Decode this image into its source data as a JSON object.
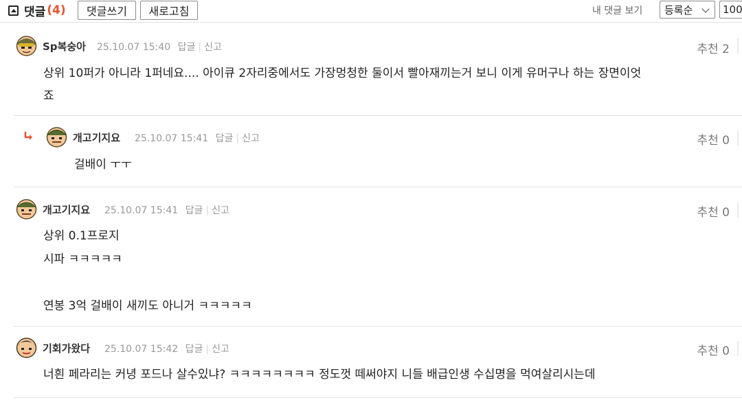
{
  "header": {
    "title": "댓글",
    "count": "(4)",
    "write_button": "댓글쓰기",
    "refresh_button": "새로고침",
    "my_comments": "내 댓글 보기",
    "sort_selected": "등록순",
    "per_page": "100"
  },
  "comments": [
    {
      "nickname": "Sp복숭아",
      "date": "25.10.07 15:40",
      "reply_label": "답글",
      "report_label": "신고",
      "recommend": "추천 2",
      "lines": [
        "상위 10퍼가 아니라 1퍼네요.... 아이큐 2자리중에서도 가장멍청한 둘이서 빨아재끼는거 보니 이게 유머구나 하는 장면이엇",
        "죠"
      ]
    },
    {
      "nickname": "개고기지요",
      "date": "25.10.07 15:41",
      "reply_label": "답글",
      "report_label": "신고",
      "recommend": "추천 0",
      "lines": [
        "걸배이 ㅜㅜ"
      ]
    },
    {
      "nickname": "개고기지요",
      "date": "25.10.07 15:41",
      "reply_label": "답글",
      "report_label": "신고",
      "recommend": "추천 0",
      "lines": [
        "상위 0.1프로지",
        "시파 ㅋㅋㅋㅋㅋ",
        "연봉 3억 걸배이 새끼도 아니거 ㅋㅋㅋㅋㅋ"
      ]
    },
    {
      "nickname": "기회가왔다",
      "date": "25.10.07 15:42",
      "reply_label": "답글",
      "report_label": "신고",
      "recommend": "추천 0",
      "lines": [
        "너흰 페라리는 커녕 포드나 살수있냐? ㅋㅋㅋㅋㅋㅋㅋㅋ 정도껏 떼써야지 니들 배급인생 수십명을 먹여살리시는데"
      ]
    }
  ],
  "colors": {
    "count_accent": "#e8532d",
    "reply_arrow": "#e8532d",
    "meta_text": "#999999",
    "separator": "#e4e4e4"
  }
}
